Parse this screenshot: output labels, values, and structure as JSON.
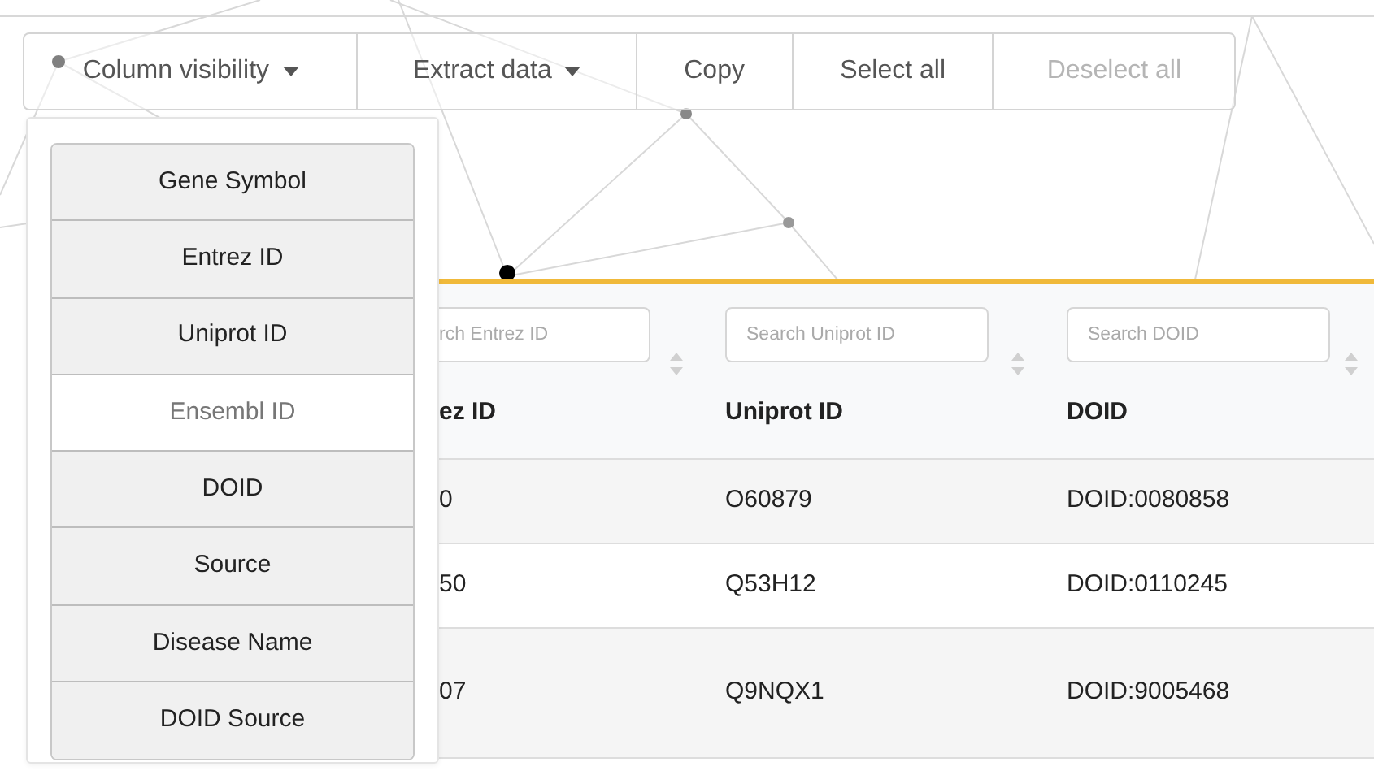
{
  "toolbar": {
    "buttons": [
      {
        "label": "Column visibility",
        "dropdown": true,
        "disabled": false
      },
      {
        "label": "Extract data",
        "dropdown": true,
        "disabled": false
      },
      {
        "label": "Copy",
        "dropdown": false,
        "disabled": false
      },
      {
        "label": "Select all",
        "dropdown": false,
        "disabled": false
      },
      {
        "label": "Deselect all",
        "dropdown": false,
        "disabled": true
      }
    ]
  },
  "column_menu": {
    "items": [
      {
        "label": "Gene Symbol",
        "visible": true
      },
      {
        "label": "Entrez ID",
        "visible": true
      },
      {
        "label": "Uniprot ID",
        "visible": true
      },
      {
        "label": "Ensembl ID",
        "visible": false
      },
      {
        "label": "DOID",
        "visible": true
      },
      {
        "label": "Source",
        "visible": true
      },
      {
        "label": "Disease Name",
        "visible": true
      },
      {
        "label": "DOID Source",
        "visible": true
      }
    ]
  },
  "table": {
    "columns": [
      {
        "placeholder": "rch Entrez ID",
        "header": "ez ID"
      },
      {
        "placeholder": "Search Uniprot ID",
        "header": "Uniprot ID"
      },
      {
        "placeholder": "Search DOID",
        "header": "DOID"
      }
    ],
    "rows": [
      [
        "0",
        "O60879",
        "DOID:0080858"
      ],
      [
        "50",
        "Q53H12",
        "DOID:0110245"
      ],
      [
        "07",
        "Q9NQX1",
        "DOID:9005468"
      ]
    ]
  }
}
